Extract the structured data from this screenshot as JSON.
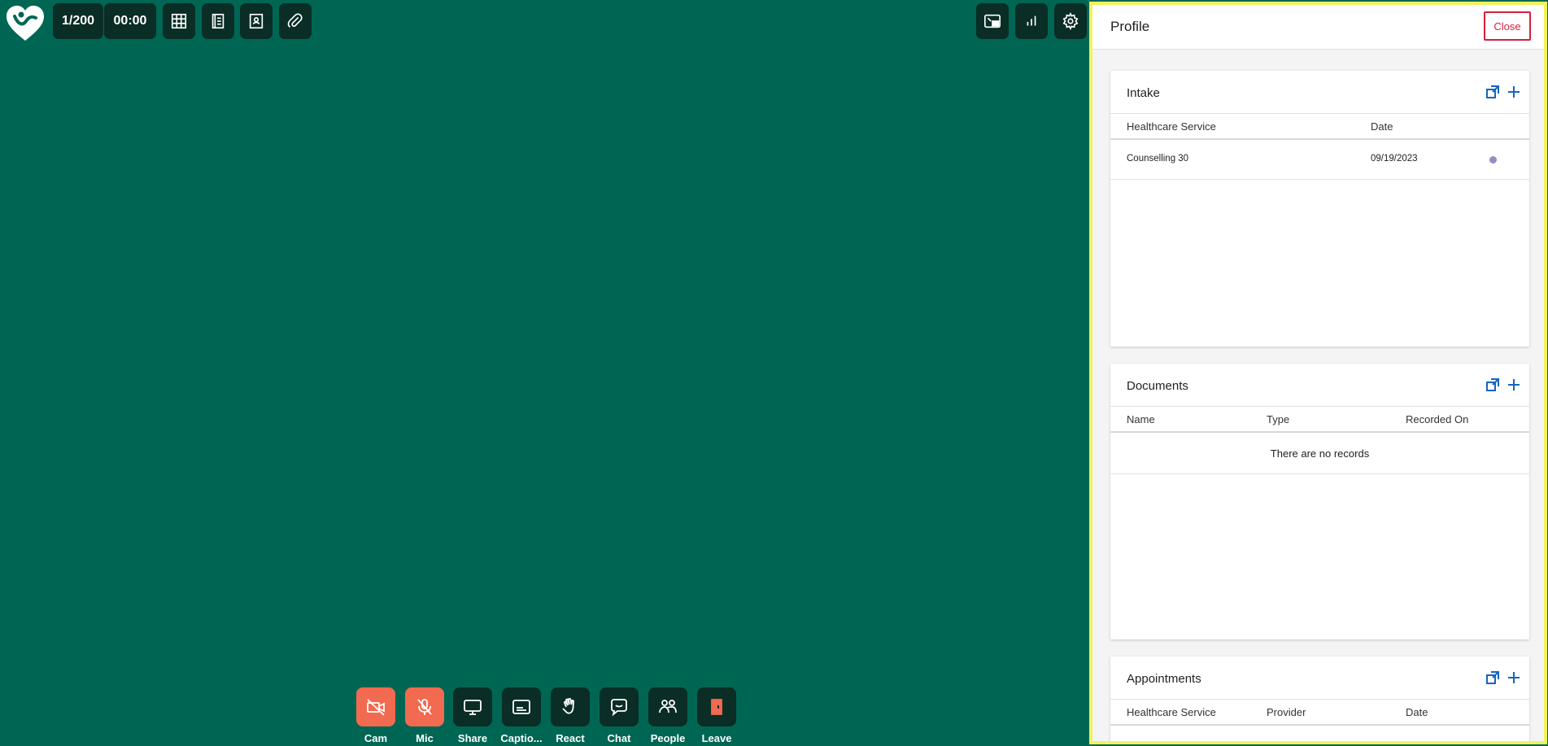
{
  "toolbar": {
    "participants": "1/200",
    "timer": "00:00",
    "buttons": [
      {
        "icon": "grid-icon"
      },
      {
        "icon": "notes-icon"
      },
      {
        "icon": "contact-card-icon"
      },
      {
        "icon": "paperclip-icon"
      }
    ],
    "right_buttons": [
      {
        "icon": "picture-in-picture-icon"
      },
      {
        "icon": "bar-chart-icon"
      },
      {
        "icon": "gear-icon"
      }
    ]
  },
  "controls": [
    {
      "label": "Cam",
      "icon": "camera-off-icon",
      "state": "off"
    },
    {
      "label": "Mic",
      "icon": "mic-off-icon",
      "state": "off"
    },
    {
      "label": "Share",
      "icon": "monitor-icon"
    },
    {
      "label": "Captio...",
      "icon": "captions-icon"
    },
    {
      "label": "React",
      "icon": "hand-wave-icon"
    },
    {
      "label": "Chat",
      "icon": "chat-icon"
    },
    {
      "label": "People",
      "icon": "people-icon"
    },
    {
      "label": "Leave",
      "icon": "door-exit-icon"
    }
  ],
  "profile": {
    "title": "Profile",
    "close_label": "Close",
    "intake": {
      "title": "Intake",
      "columns": [
        "Healthcare Service",
        "Date"
      ],
      "rows": [
        {
          "service": "Counselling 30",
          "date": "09/19/2023"
        }
      ]
    },
    "documents": {
      "title": "Documents",
      "columns": [
        "Name",
        "Type",
        "Recorded On"
      ],
      "empty_text": "There are no records"
    },
    "appointments": {
      "title": "Appointments",
      "columns": [
        "Healthcare Service",
        "Provider",
        "Date"
      ]
    }
  },
  "colors": {
    "background": "#006654",
    "button_dark": "#0a2d26",
    "button_off": "#f26a4f",
    "panel_border": "#f2f25a",
    "close": "#d6203a",
    "link_icon": "#1565c0",
    "status_dot": "#9b8bc4"
  }
}
